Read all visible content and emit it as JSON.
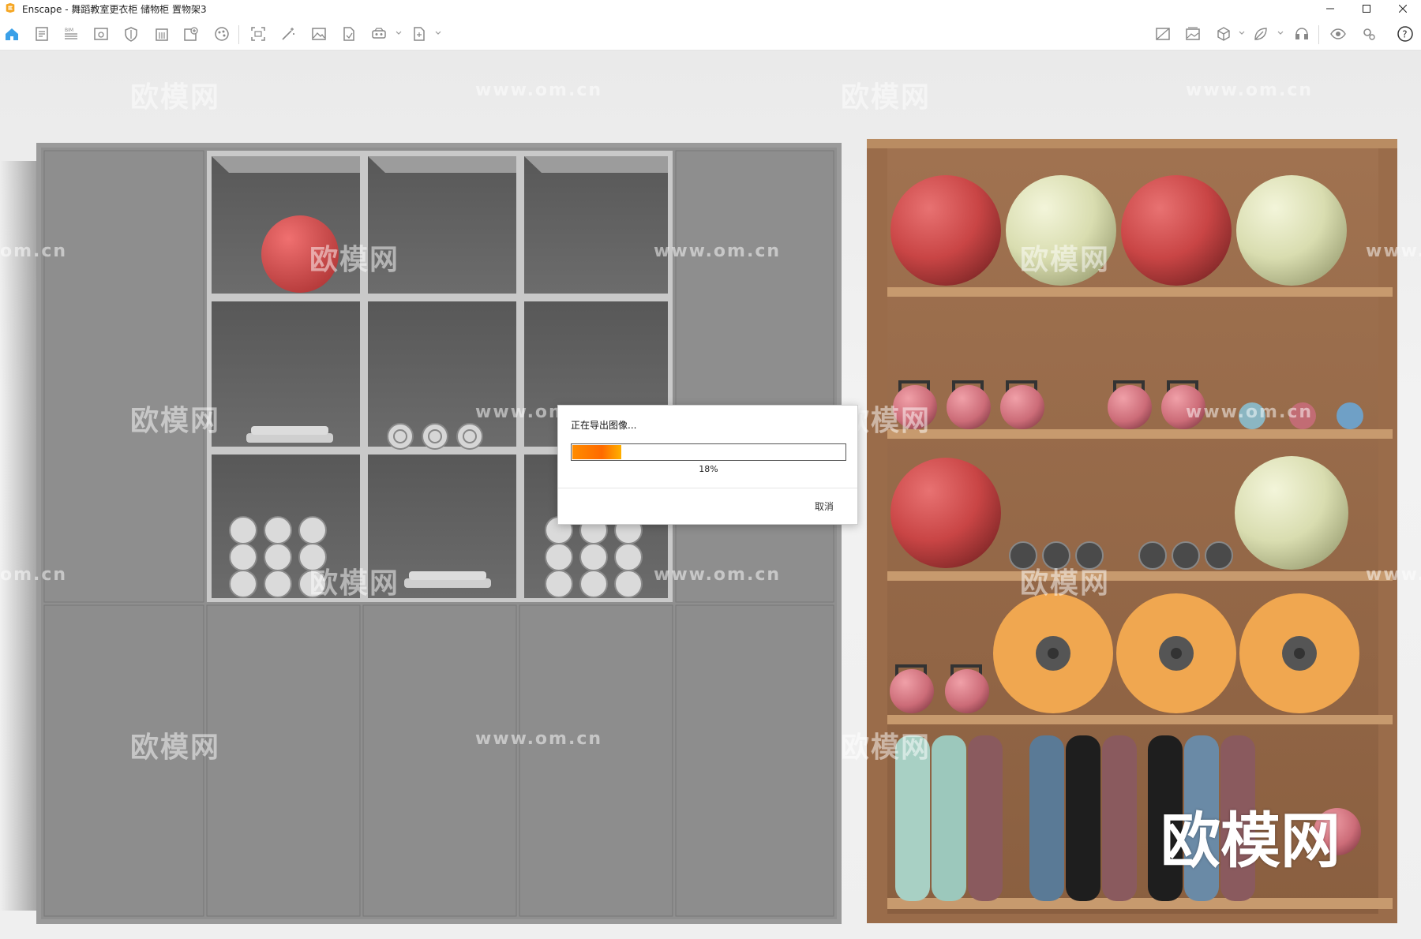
{
  "titlebar": {
    "title": "Enscape - 舞蹈教室更衣柜 储物柜 置物架3"
  },
  "toolbar": {
    "left_icons": [
      "home-icon",
      "document-list-icon",
      "bim-icon",
      "view-icon",
      "shield-icon",
      "building-icon",
      "add-asset-icon",
      "material-icon",
      "capture-icon",
      "magic-wand-icon",
      "image-icon",
      "file-export-icon",
      "vr-headset-icon",
      "export-icon"
    ],
    "right_icons": [
      "image-compare-icon",
      "gallery-icon",
      "cube-icon",
      "leaf-icon",
      "headset-icon",
      "eye-icon",
      "settings-icon",
      "help-icon"
    ]
  },
  "watermarks": {
    "brand": "欧模网",
    "site": "www.om.cn",
    "site_partial": "om.cn",
    "site_partial_right": "www.o"
  },
  "big_watermark": "欧模网",
  "export_dialog": {
    "title": "正在导出图像...",
    "progress": 0.18,
    "progress_text": "18%",
    "cancel_label": "取消"
  },
  "colors": {
    "accent": "#ff8c00",
    "home_icon": "#3aa0e8",
    "app_icon": "#f5a623"
  }
}
